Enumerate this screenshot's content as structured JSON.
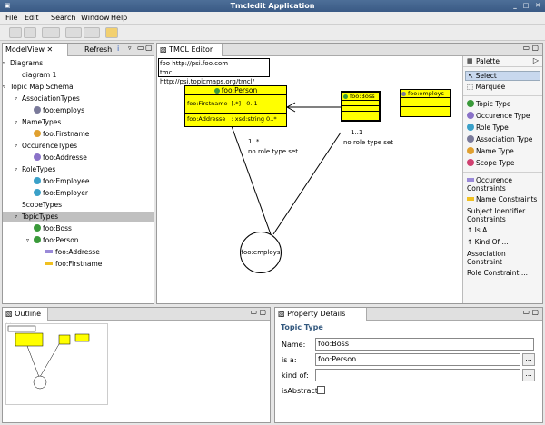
{
  "window": {
    "title": "Tmcledit Application"
  },
  "menu": {
    "file": "File",
    "edit": "Edit",
    "search": "Search",
    "window": "Window",
    "help": "Help"
  },
  "modelview": {
    "tab": "ModelView",
    "refresh": "Refresh",
    "tree": [
      {
        "label": "Diagrams",
        "level": 0,
        "twisty": "down"
      },
      {
        "label": "diagram 1",
        "level": 1,
        "twisty": ""
      },
      {
        "label": "Topic Map Schema",
        "level": 0,
        "twisty": "down"
      },
      {
        "label": "AssociationTypes",
        "level": 1,
        "twisty": "down"
      },
      {
        "label": "foo:employs",
        "level": 2,
        "icon": "association-type-icon",
        "color": "#7a7a9a"
      },
      {
        "label": "NameTypes",
        "level": 1,
        "twisty": "down"
      },
      {
        "label": "foo:Firstname",
        "level": 2,
        "icon": "name-type-icon",
        "color": "#e0a030"
      },
      {
        "label": "OccurenceTypes",
        "level": 1,
        "twisty": "down"
      },
      {
        "label": "foo:Addresse",
        "level": 2,
        "icon": "occurence-type-icon",
        "color": "#8a72c8"
      },
      {
        "label": "RoleTypes",
        "level": 1,
        "twisty": "down"
      },
      {
        "label": "foo:Employee",
        "level": 2,
        "icon": "role-type-icon",
        "color": "#3aa0c8"
      },
      {
        "label": "foo:Employer",
        "level": 2,
        "icon": "role-type-icon",
        "color": "#3aa0c8"
      },
      {
        "label": "ScopeTypes",
        "level": 1,
        "twisty": ""
      },
      {
        "label": "TopicTypes",
        "level": 1,
        "twisty": "down",
        "selected": true
      },
      {
        "label": "foo:Boss",
        "level": 2,
        "icon": "topic-type-icon",
        "color": "#3a9a3a"
      },
      {
        "label": "foo:Person",
        "level": 2,
        "twisty": "down",
        "icon": "topic-type-icon",
        "color": "#3a9a3a"
      },
      {
        "label": "foo:Addresse",
        "level": 3,
        "icon": "occurence-constraint-icon",
        "color": "#9a8ad8",
        "bar": true
      },
      {
        "label": "foo:Firstname",
        "level": 3,
        "icon": "name-constraint-icon",
        "color": "#f0c020",
        "bar": true
      }
    ]
  },
  "editor": {
    "tab": "TMCL Editor",
    "prefixes": [
      "foo http://psi.foo.com",
      "tmcl http://psi.topicmaps.org/tmcl/"
    ],
    "person": {
      "title": "foo:Person",
      "rows": [
        "foo:Firstname  [.*]   0..1",
        "foo:Addresse   : xsd:string 0..*"
      ]
    },
    "boss": {
      "title": "foo:Boss"
    },
    "employs_top": {
      "title": "foo:employs"
    },
    "assoc": {
      "label": "foo:employs"
    },
    "card_left": "1..*",
    "role_left": "no role type set",
    "card_right": "1..1",
    "role_right": "no role type set"
  },
  "palette": {
    "title": "Palette",
    "tools": [
      {
        "label": "Select"
      },
      {
        "label": "Marquee"
      }
    ],
    "types": [
      {
        "label": "Topic Type",
        "color": "#3a9a3a"
      },
      {
        "label": "Occurence Type",
        "color": "#8a72c8"
      },
      {
        "label": "Role Type",
        "color": "#3aa0c8"
      },
      {
        "label": "Association Type",
        "color": "#7a7a9a"
      },
      {
        "label": "Name Type",
        "color": "#e0a030"
      },
      {
        "label": "Scope Type",
        "color": "#d04070"
      }
    ],
    "constraints": [
      {
        "label": "Occurence\nConstraints",
        "color": "#9a8ad8"
      },
      {
        "label": "Name Constraints",
        "color": "#f0c020"
      },
      {
        "label": "Subject Identifier\nConstraints",
        "color": ""
      },
      {
        "label": "Is A ...",
        "color": ""
      },
      {
        "label": "Kind Of ...",
        "color": ""
      },
      {
        "label": "Association\nConstraint",
        "color": ""
      },
      {
        "label": "Role Constraint ...",
        "color": ""
      }
    ]
  },
  "outline": {
    "tab": "Outline"
  },
  "properties": {
    "tab": "Property Details View",
    "section": "Topic Type",
    "name_label": "Name:",
    "name_value": "foo:Boss",
    "isa_label": "is a:",
    "isa_value": "foo:Person",
    "kindof_label": "kind of:",
    "kindof_value": "",
    "abstract_label": "isAbstract",
    "ellipsis": "..."
  }
}
